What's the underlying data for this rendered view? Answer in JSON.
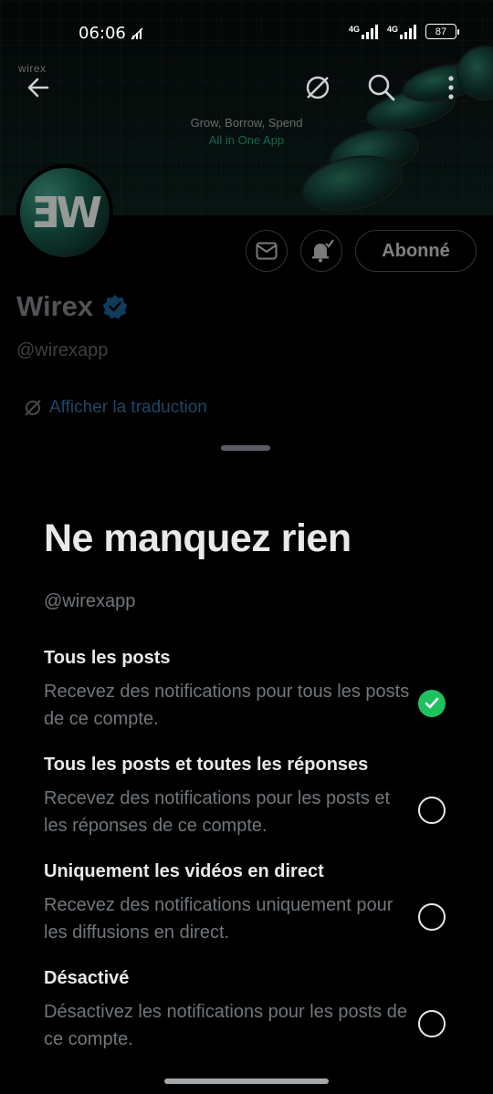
{
  "status_bar": {
    "time": "06:06",
    "network_1": "4G",
    "network_2": "4G",
    "battery": "87"
  },
  "banner": {
    "brand": "wirex",
    "headline": "Grow, Borrow, Spend",
    "subheadline": "All in One App"
  },
  "profile": {
    "avatar_mark": "ƎW",
    "follow_label": "Abonné",
    "name": "Wirex",
    "handle": "@wirexapp",
    "translate_label": "Afficher la traduction"
  },
  "sheet": {
    "title": "Ne manquez rien",
    "handle": "@wirexapp",
    "options": [
      {
        "title": "Tous les posts",
        "description": "Recevez des notifications pour tous les posts de ce compte.",
        "selected": true
      },
      {
        "title": "Tous les posts et toutes les réponses",
        "description": "Recevez des notifications pour les posts et les réponses de ce compte.",
        "selected": false
      },
      {
        "title": "Uniquement les vidéos en direct",
        "description": "Recevez des notifications uniquement pour les diffusions en direct.",
        "selected": false
      },
      {
        "title": "Désactivé",
        "description": "Désactivez les notifications pour les posts de ce compte.",
        "selected": false
      }
    ]
  },
  "colors": {
    "accent_green": "#1fc15f",
    "link_blue": "#2e6d9e",
    "verified_blue": "#1d9bf0"
  }
}
